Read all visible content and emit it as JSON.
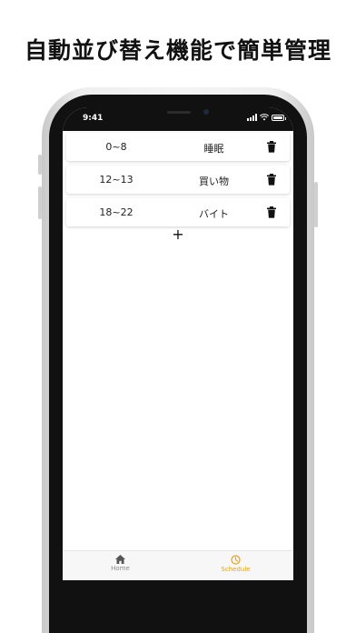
{
  "headline": "自動並び替え機能で簡単管理",
  "status_bar": {
    "time": "9:41"
  },
  "schedule": {
    "items": [
      {
        "time": "0~8",
        "task": "睡眠"
      },
      {
        "time": "12~13",
        "task": "買い物"
      },
      {
        "time": "18~22",
        "task": "バイト"
      }
    ],
    "add_label": "+"
  },
  "tabbar": {
    "tabs": [
      {
        "label": "Home",
        "icon": "home-icon",
        "active": false
      },
      {
        "label": "Schedule",
        "icon": "clock-icon",
        "active": true
      }
    ]
  },
  "colors": {
    "accent": "#f4a300",
    "inactive": "#8a8a8a"
  }
}
